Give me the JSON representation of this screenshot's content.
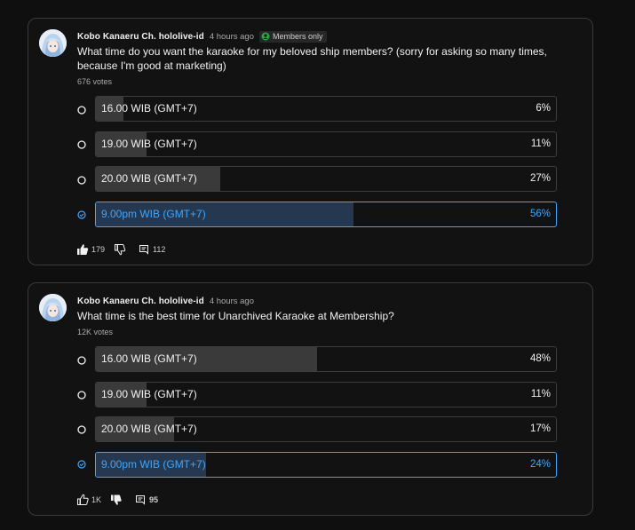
{
  "posts": [
    {
      "author": "Kobo Kanaeru Ch. hololive-id",
      "time": "4 hours ago",
      "badge": "Members only",
      "question": "What time do you want the karaoke for my beloved ship members? (sorry for asking so many times, because I'm good at marketing)",
      "votes": "676 votes",
      "options": [
        {
          "label": "16.00 WIB (GMT+7)",
          "percent": "6%",
          "fill": 0.06,
          "selected": false
        },
        {
          "label": "19.00 WIB (GMT+7)",
          "percent": "11%",
          "fill": 0.11,
          "selected": false
        },
        {
          "label": "20.00 WIB (GMT+7)",
          "percent": "27%",
          "fill": 0.27,
          "selected": false
        },
        {
          "label": "9.00pm WIB (GMT+7)",
          "percent": "56%",
          "fill": 0.56,
          "selected": true
        }
      ],
      "likes": "179",
      "comments": "112",
      "liked": true,
      "disliked": false
    },
    {
      "author": "Kobo Kanaeru Ch. hololive-id",
      "time": "4 hours ago",
      "question": "What time is the best time for Unarchived Karaoke at Membership?",
      "votes": "12K votes",
      "options": [
        {
          "label": "16.00 WIB (GMT+7)",
          "percent": "48%",
          "fill": 0.48,
          "selected": false
        },
        {
          "label": "19.00 WIB (GMT+7)",
          "percent": "11%",
          "fill": 0.11,
          "selected": false
        },
        {
          "label": "20.00 WIB (GMT+7)",
          "percent": "17%",
          "fill": 0.17,
          "selected": false
        },
        {
          "label": "9.00pm WIB (GMT+7)",
          "percent": "24%",
          "fill": 0.24,
          "selected": true
        }
      ],
      "likes": "1K",
      "comments": "95",
      "liked": false,
      "disliked": true
    }
  ],
  "colors": {
    "accent": "#3ea6ff",
    "bar": "#3a3a3a",
    "selected_bar": "#263850",
    "badge_icon": "#2ba640"
  }
}
